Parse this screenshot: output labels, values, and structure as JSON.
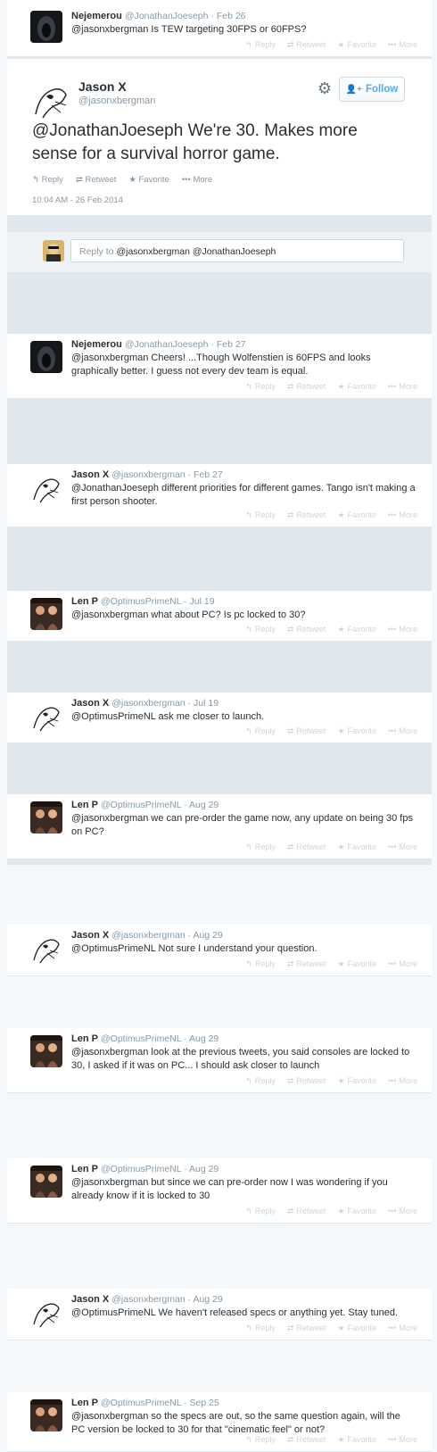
{
  "top_tweet": {
    "name": "Nejemerou",
    "meta": "@JonathanJoeseph · Feb 26",
    "text": "@jasonxbergman Is TEW targeting 30FPS or 60FPS?"
  },
  "actions": {
    "reply": "Reply",
    "retweet": "Retweet",
    "favorite": "Favorite",
    "more": "More"
  },
  "main_tweet": {
    "name": "Jason X",
    "handle": "@jasonxbergman",
    "follow_label": "Follow",
    "text": "@JonathanJoeseph We're 30. Makes more sense for a survival horror game.",
    "timestamp": "10:04 AM - 26 Feb 2014"
  },
  "reply_box": {
    "prefix": "Reply to",
    "recipients": "@jasonxbergman @JonathanJoeseph"
  },
  "replies": [
    {
      "name": "Nejemerou",
      "meta": "@JonathanJoeseph · Feb 27",
      "text": "@jasonxbergman Cheers! ...Though Wolfenstien is 60FPS and looks graphically better. I guess not every dev team is equal."
    },
    {
      "name": "Jason X",
      "meta": "@jasonxbergman · Feb 27",
      "text": "@JonathanJoeseph different priorities for different games. Tango isn't making a first person shooter."
    },
    {
      "name": "Len P",
      "meta": "@OptimusPrimeNL · Jul 19",
      "text": "@jasonxbergman what about PC? Is pc locked to 30?"
    },
    {
      "name": "Jason X",
      "meta": "@jasonxbergman · Jul 19",
      "text": "@OptimusPrimeNL ask me closer to launch."
    },
    {
      "name": "Len P",
      "meta": "@OptimusPrimeNL · Aug 29",
      "text": "@jasonxbergman we can pre-order the game now, any update on being 30 fps on PC?"
    },
    {
      "name": "Jason X",
      "meta": "@jasonxbergman · Aug 29",
      "text": "@OptimusPrimeNL Not sure I understand your question."
    },
    {
      "name": "Len P",
      "meta": "@OptimusPrimeNL · Aug 29",
      "text": "@jasonxbergman look at the previous tweets, you said consoles are locked to 30, I asked if it was on PC... I should ask closer to launch"
    },
    {
      "name": "Len P",
      "meta": "@OptimusPrimeNL · Aug 29",
      "text": "@jasonxbergman but since we can pre-order now I was wondering if you already know if it is locked to 30"
    },
    {
      "name": "Jason X",
      "meta": "@jasonxbergman · Aug 29",
      "text": "@OptimusPrimeNL We haven't released specs or anything yet. Stay tuned."
    },
    {
      "name": "Len P",
      "meta": "@OptimusPrimeNL · Sep 25",
      "text": "@jasonxbergman so the specs are out, so the same question again, will the PC version be locked to 30 for that \"cinematic feel\" or not?"
    }
  ]
}
